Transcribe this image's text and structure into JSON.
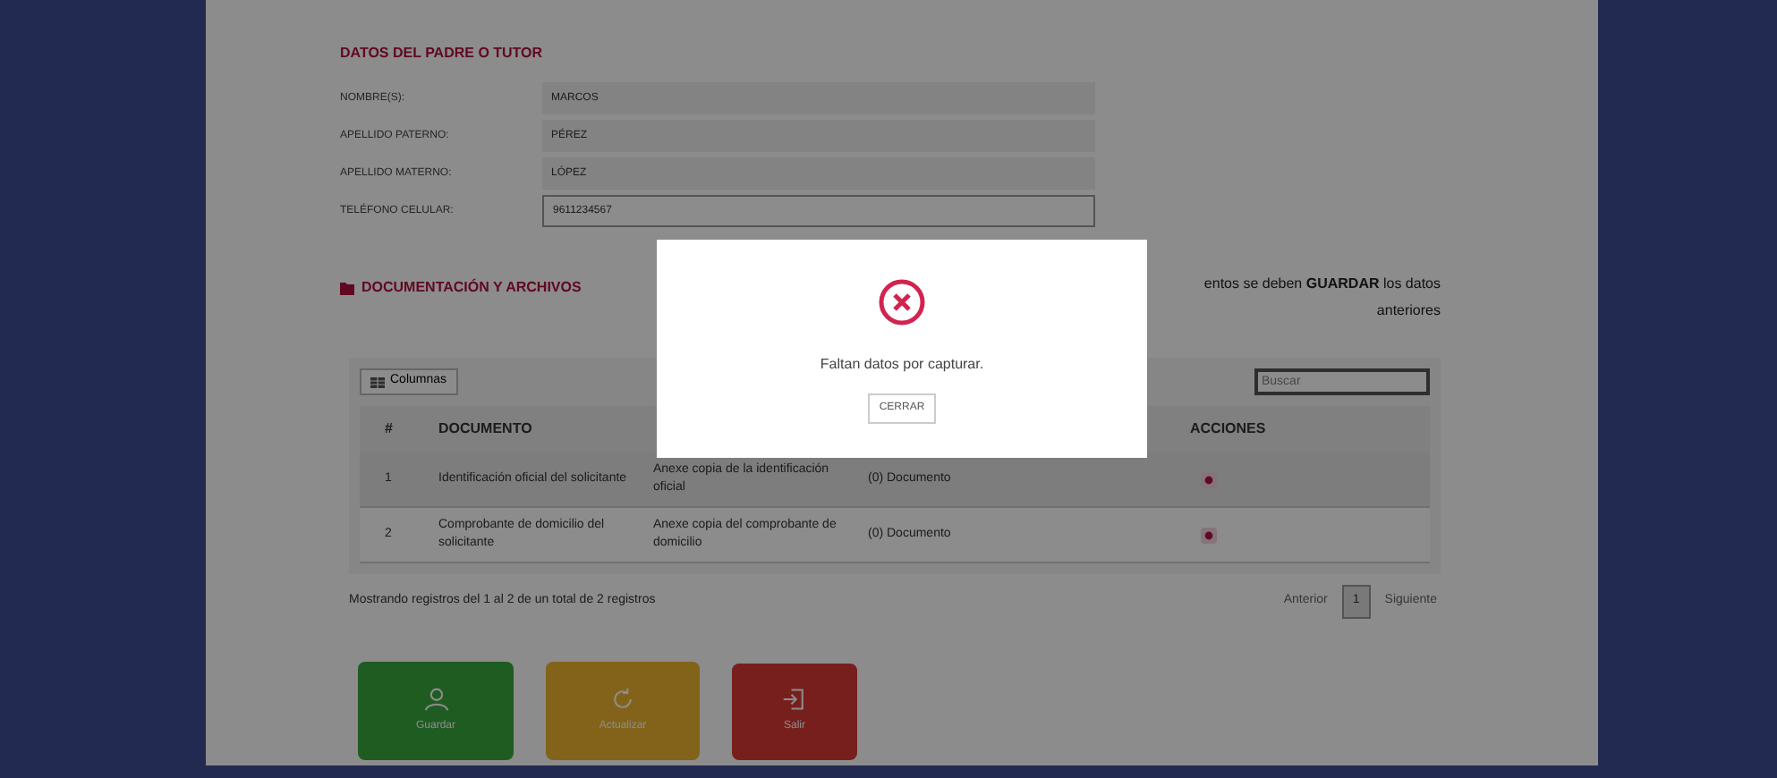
{
  "tutor": {
    "title": "DATOS DEL PADRE O TUTOR",
    "fields": [
      {
        "label": "NOMBRE(S):",
        "value": "MARCOS"
      },
      {
        "label": "APELLIDO PATERNO:",
        "value": "PÉREZ"
      },
      {
        "label": "APELLIDO MATERNO:",
        "value": "LÓPEZ"
      },
      {
        "label": "TELÉFONO CELULAR:",
        "value": "9611234567"
      }
    ]
  },
  "documents": {
    "title": "DOCUMENTACIÓN Y ARCHIVOS",
    "notice_line_1": "entos se deben **GUARDAR** los datos",
    "notice_line_2": "anteriores",
    "columns_button": "Columnas",
    "search_placeholder": "Buscar",
    "header": {
      "number": "#",
      "document": "DOCUMENTO",
      "actions": "ACCIONES"
    },
    "rows": [
      {
        "number": "1",
        "document": "Identificación oficial del solicitante",
        "description": "Anexe copia de la identificación oficial",
        "files": "(0) Documento"
      },
      {
        "number": "2",
        "document": "Comprobante de domicilio del solicitante",
        "description": "Anexe copia del comprobante de domicilio",
        "files": "(0) Documento"
      }
    ],
    "summary": "Mostrando registros del 1 al 2 de un total de 2 registros",
    "pagination": [
      {
        "label": "Anterior",
        "selected": false
      },
      {
        "label": "1",
        "selected": true
      },
      {
        "label": "Siguiente",
        "selected": false
      }
    ]
  },
  "actions": [
    {
      "kind": "save",
      "label": "Guardar"
    },
    {
      "kind": "update",
      "label": "Actualizar"
    },
    {
      "kind": "exit",
      "label": "Salir"
    }
  ],
  "modal": {
    "message": "Faltan datos por capturar.",
    "button": "CERRAR"
  }
}
